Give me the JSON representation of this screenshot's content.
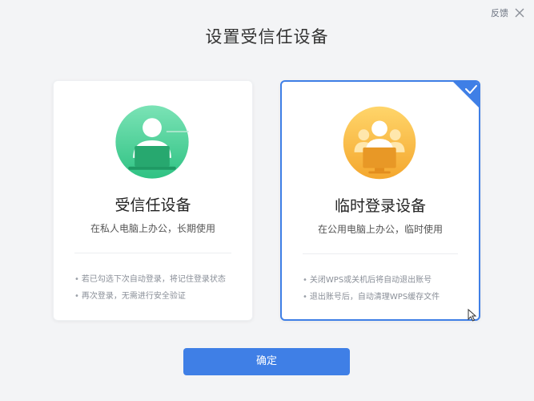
{
  "header": {
    "feedback_label": "反馈",
    "close_icon": "close-icon",
    "title": "设置受信任设备"
  },
  "options": [
    {
      "title": "受信任设备",
      "description": "在私人电脑上办公，长期使用",
      "notes": [
        "若已勾选下次自动登录，将记住登录状态",
        "再次登录，无需进行安全验证"
      ],
      "icon": "trusted-device-icon",
      "accent_color": "#35c98f",
      "selected": false
    },
    {
      "title": "临时登录设备",
      "description": "在公用电脑上办公，临时使用",
      "notes": [
        "关闭WPS或关机后将自动退出账号",
        "退出账号后，自动清理WPS缓存文件"
      ],
      "icon": "temporary-device-icon",
      "accent_color": "#f5b83a",
      "selected": true
    }
  ],
  "footer": {
    "confirm_label": "确定"
  },
  "colors": {
    "primary": "#3f7fe6",
    "background": "#f3f4f6"
  }
}
